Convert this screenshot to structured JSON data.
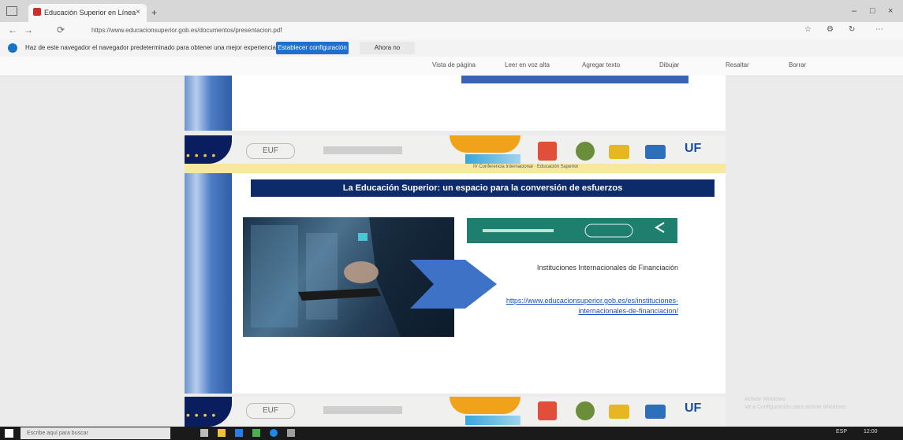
{
  "browser": {
    "tab_title": "Educación Superior en Línea",
    "tab_close": "×",
    "new_tab": "+",
    "window_controls": [
      "–",
      "□",
      "×"
    ],
    "url": "https://www.educacionsuperior.gob.es/documentos/presentacion.pdf",
    "nav": [
      "←",
      "→",
      "⟳"
    ],
    "toolbar_icons": [
      "☆",
      "⚙",
      "↻",
      "⋯"
    ]
  },
  "infobar": {
    "text": "Haz de este navegador el navegador predeterminado para obtener una mejor experiencia",
    "primary_button": "Establecer configuración",
    "secondary_button": "Ahora no"
  },
  "pdf_toolbar": {
    "items": [
      "Vista de página",
      "Leer en voz alta",
      "Agregar texto",
      "Dibujar",
      "Resaltar",
      "Borrar"
    ]
  },
  "slide": {
    "header_right_text": "IV Conferencia Internacional · Educación Superior",
    "header_logo_left": "EUF",
    "title": "La Educación Superior: un espacio para la conversión de esfuerzos",
    "institutions_label": "Instituciones Internacionales de Financiación",
    "link": "https://www.educacionsuperior.gob.es/es/instituciones-internacionales-de-financiacion/",
    "logo_text": "UF"
  },
  "watermark": {
    "line1": "Activar Windows",
    "line2": "Ve a Configuración para activar Windows."
  },
  "taskbar": {
    "search_placeholder": "Escribe aquí para buscar",
    "tray_text": "ESP",
    "clock": "12:00"
  }
}
